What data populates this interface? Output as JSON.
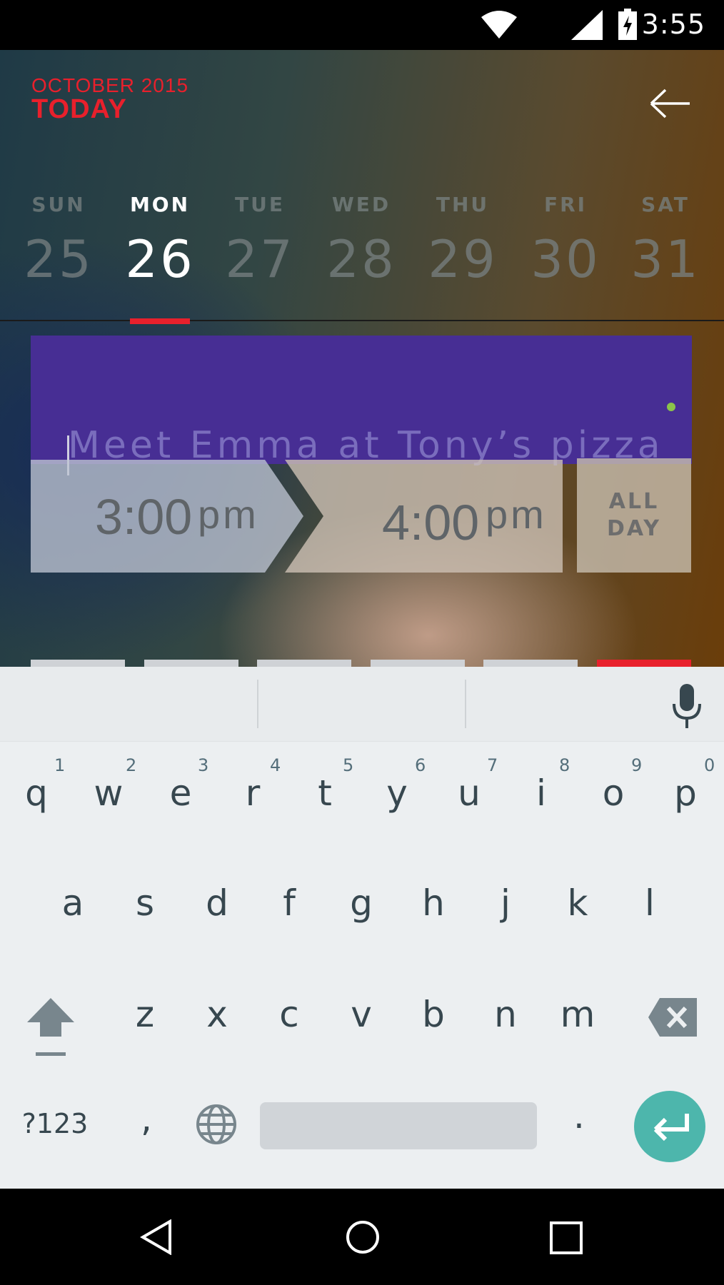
{
  "status_bar": {
    "time": "3:55"
  },
  "header": {
    "month": "OCTOBER 2015",
    "title": "TODAY"
  },
  "week": {
    "days": [
      {
        "name": "SUN",
        "num": "25"
      },
      {
        "name": "MON",
        "num": "26"
      },
      {
        "name": "TUE",
        "num": "27"
      },
      {
        "name": "WED",
        "num": "28"
      },
      {
        "name": "THU",
        "num": "29"
      },
      {
        "name": "FRI",
        "num": "30"
      },
      {
        "name": "SAT",
        "num": "31"
      }
    ],
    "selected": "MON"
  },
  "event": {
    "placeholder": "Meet Emma at Tony’s pizza",
    "value": ""
  },
  "time": {
    "start_time": "3:00",
    "start_ampm": "pm",
    "end_time": "4:00",
    "end_ampm": "pm",
    "allday_line1": "ALL",
    "allday_line2": "DAY"
  },
  "keyboard": {
    "row1": [
      "q",
      "w",
      "e",
      "r",
      "t",
      "y",
      "u",
      "i",
      "o",
      "p"
    ],
    "row1_hints": [
      "1",
      "2",
      "3",
      "4",
      "5",
      "6",
      "7",
      "8",
      "9",
      "0"
    ],
    "row2": [
      "a",
      "s",
      "d",
      "f",
      "g",
      "h",
      "j",
      "k",
      "l"
    ],
    "row3": [
      "z",
      "x",
      "c",
      "v",
      "b",
      "n",
      "m"
    ],
    "symbols": "?123",
    "comma": ",",
    "period": "."
  },
  "colors": {
    "accent": "#e8202c",
    "event_bg": "#472e94",
    "enter_key": "#4db6ac",
    "dot": "#8bc34a"
  },
  "icons": [
    "wifi-icon",
    "signal-icon",
    "battery-charging-icon",
    "back-arrow-icon",
    "mic-icon",
    "shift-icon",
    "backspace-icon",
    "globe-icon",
    "enter-icon",
    "nav-back-icon",
    "nav-home-icon",
    "nav-recents-icon"
  ]
}
